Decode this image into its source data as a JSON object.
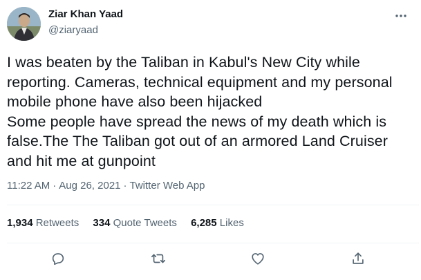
{
  "author": {
    "display_name": "Ziar Khan Yaad",
    "handle": "@ziaryaad"
  },
  "tweet": {
    "text": "I was beaten by the Taliban in Kabul's New City while reporting. Cameras, technical equipment and my personal mobile phone have also been hijacked\nSome people have spread the news of my death which is false.The The Taliban got out of an armored Land Cruiser and hit me at gunpoint",
    "time": "11:22 AM",
    "separator": "·",
    "date": "Aug 26, 2021",
    "source_app": "Twitter Web App"
  },
  "stats": {
    "retweets_count": "1,934",
    "retweets_label": "Retweets",
    "quotes_count": "334",
    "quotes_label": "Quote Tweets",
    "likes_count": "6,285",
    "likes_label": "Likes"
  },
  "icons": {
    "more": "more-horizontal-icon",
    "reply": "reply-icon",
    "retweet": "retweet-icon",
    "like": "heart-icon",
    "share": "share-icon"
  },
  "colors": {
    "text": "#0f1419",
    "secondary": "#536471",
    "divider": "#eff3f4",
    "background": "#ffffff"
  }
}
